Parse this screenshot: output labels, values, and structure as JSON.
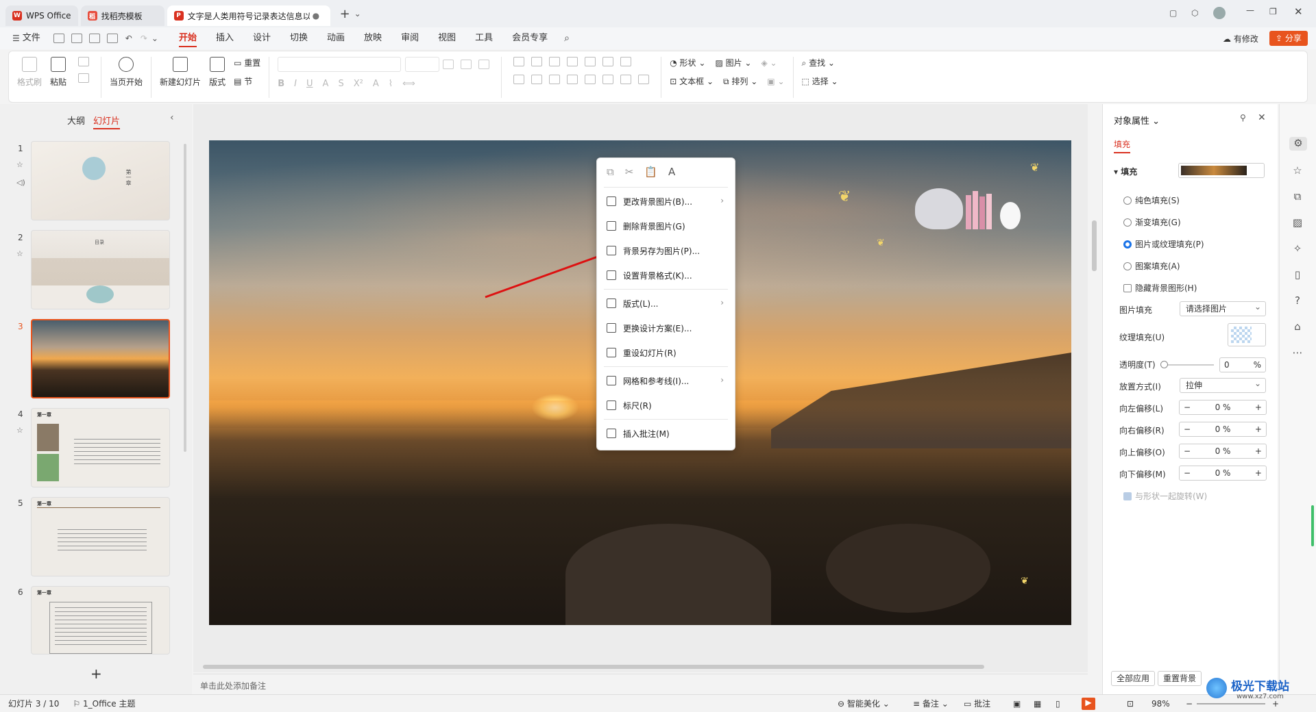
{
  "tabs": [
    {
      "label": "WPS Office"
    },
    {
      "label": "找稻壳模板"
    },
    {
      "label": "文字是人类用符号记录表达信息以"
    }
  ],
  "menu": {
    "file": "文件",
    "items": [
      "开始",
      "插入",
      "设计",
      "切换",
      "动画",
      "放映",
      "审阅",
      "视图",
      "工具",
      "会员专享"
    ],
    "edit_status": "有修改",
    "share": "分享"
  },
  "ribbon": {
    "format_painter": "格式刷",
    "paste": "粘贴",
    "play_from_current": "当页开始",
    "new_slide": "新建幻灯片",
    "layout": "版式",
    "reset": "重置",
    "section": "节",
    "shape": "形状",
    "picture": "图片",
    "textbox": "文本框",
    "arrange": "排列",
    "find": "查找",
    "select": "选择"
  },
  "left_panel": {
    "outline_tab": "大纲",
    "slides_tab": "幻灯片",
    "slide_numbers": [
      "1",
      "2",
      "3",
      "4",
      "5",
      "6"
    ],
    "add": "+"
  },
  "slide_thumbs": {
    "t1_title": "第一章",
    "t2_title": "目录",
    "chapter": "第一章"
  },
  "context_menu": {
    "items": [
      "更改背景图片(B)...",
      "删除背景图片(G)",
      "背景另存为图片(P)...",
      "设置背景格式(K)...",
      "版式(L)...",
      "更换设计方案(E)...",
      "重设幻灯片(R)",
      "网格和参考线(I)...",
      "标尺(R)",
      "插入批注(M)"
    ]
  },
  "props": {
    "title": "对象属性",
    "tab": "填充",
    "section": "填充",
    "options": [
      "纯色填充(S)",
      "渐变填充(G)",
      "图片或纹理填充(P)",
      "图案填充(A)"
    ],
    "hide_bg": "隐藏背景图形(H)",
    "picture_fill_label": "图片填充",
    "picture_fill_value": "请选择图片",
    "texture_label": "纹理填充(U)",
    "transparency_label": "透明度(T)",
    "transparency_value": "0",
    "percent": "%",
    "placement_label": "放置方式(I)",
    "placement_value": "拉伸",
    "offsets": [
      {
        "label": "向左偏移(L)",
        "value": "0 %"
      },
      {
        "label": "向右偏移(R)",
        "value": "0 %"
      },
      {
        "label": "向上偏移(O)",
        "value": "0 %"
      },
      {
        "label": "向下偏移(M)",
        "value": "0 %"
      }
    ],
    "rotate_with_shape": "与形状一起旋转(W)",
    "apply_all": "全部应用",
    "reset_bg": "重置背景"
  },
  "notes_placeholder": "单击此处添加备注",
  "status": {
    "slide_info": "幻灯片 3 / 10",
    "theme": "1_Office 主题",
    "beautify": "智能美化",
    "notes": "备注",
    "comments": "批注",
    "zoom": "98%"
  },
  "watermark": {
    "text": "极光下载站",
    "url": "www.xz7.com"
  },
  "colors": {
    "accent": "#d9301f",
    "share": "#e8541e",
    "selected_border": "#e8541e"
  }
}
